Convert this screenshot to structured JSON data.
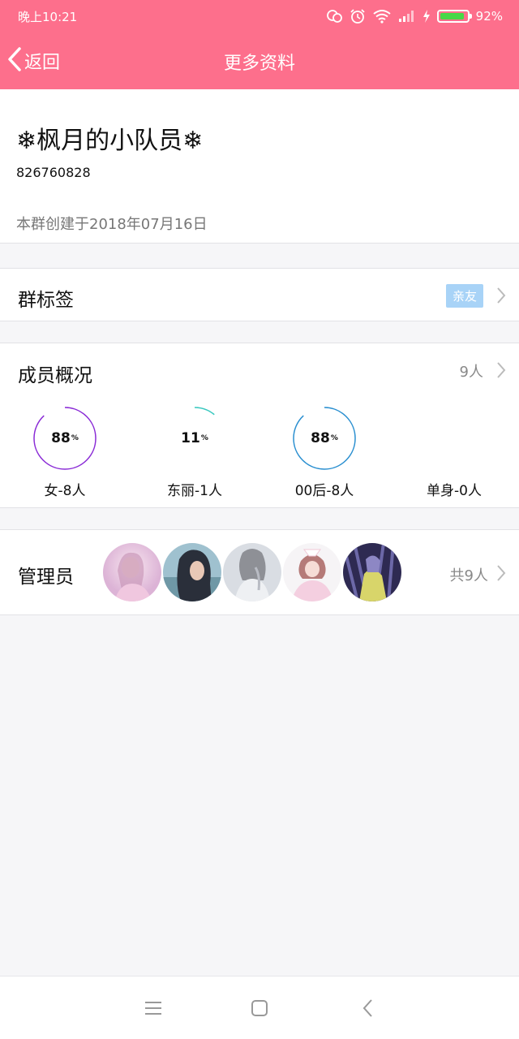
{
  "status_bar": {
    "time": "晚上10:21",
    "battery_percent": "92%",
    "battery_level": 0.92,
    "icons": [
      "wechat-icon",
      "alarm-icon",
      "wifi-icon",
      "signal-icon",
      "charging-icon",
      "battery-icon"
    ]
  },
  "nav": {
    "back_label": "返回",
    "title": "更多资料"
  },
  "group": {
    "name": "❄枫月的小队员❄",
    "id": "826760828",
    "created": "本群创建于2018年07月16日"
  },
  "tags_row": {
    "label": "群标签",
    "tag": "亲友"
  },
  "members_row": {
    "label": "成员概况",
    "count": "9人"
  },
  "member_stats": [
    {
      "pct": "88",
      "pct_value": 0.88,
      "unit": "%",
      "caption": "女-8人",
      "color": "#8a2bd6"
    },
    {
      "pct": "11",
      "pct_value": 0.11,
      "unit": "%",
      "caption": "东丽-1人",
      "color": "#3cc9c0"
    },
    {
      "pct": "88",
      "pct_value": 0.88,
      "unit": "%",
      "caption": "00后-8人",
      "color": "#2a8fd0"
    },
    {
      "pct": "",
      "pct_value": 0,
      "unit": "",
      "caption": "单身-0人",
      "color": "#cccccc"
    }
  ],
  "admins_row": {
    "label": "管理员",
    "total": "共9人",
    "avatars": [
      {
        "name": "admin-avatar-1"
      },
      {
        "name": "admin-avatar-2"
      },
      {
        "name": "admin-avatar-3"
      },
      {
        "name": "admin-avatar-4"
      },
      {
        "name": "admin-avatar-5"
      }
    ]
  },
  "colors": {
    "brand": "#fd6f8c",
    "tag_bg": "#a8d3f7"
  }
}
